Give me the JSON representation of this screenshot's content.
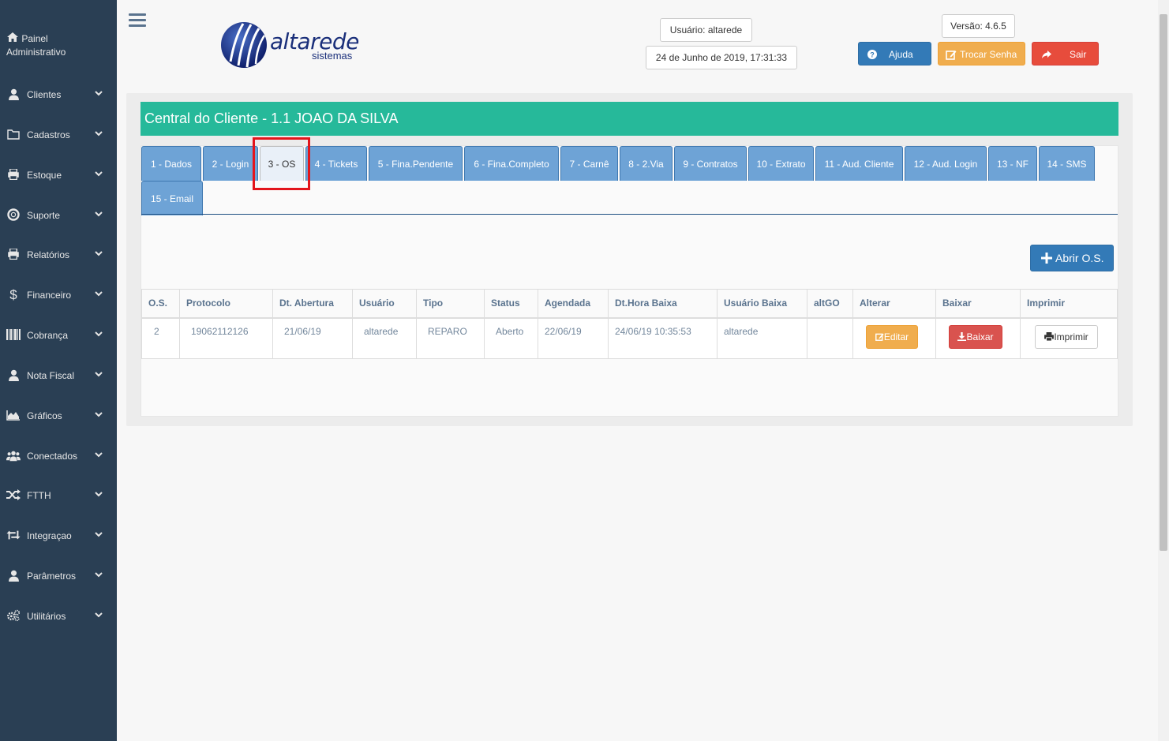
{
  "sidebar": {
    "home": {
      "line1": "Painel",
      "line2": "Administrativo"
    },
    "items": [
      {
        "label": "Clientes",
        "icon": "user-icon"
      },
      {
        "label": "Cadastros",
        "icon": "folder-icon"
      },
      {
        "label": "Estoque",
        "icon": "print-icon"
      },
      {
        "label": "Suporte",
        "icon": "life-ring-icon"
      },
      {
        "label": "Relatórios",
        "icon": "print-icon"
      },
      {
        "label": "Financeiro",
        "icon": "dollar-icon"
      },
      {
        "label": "Cobrança",
        "icon": "barcode-icon"
      },
      {
        "label": "Nota Fiscal",
        "icon": "user-icon"
      },
      {
        "label": "Gráficos",
        "icon": "area-chart-icon"
      },
      {
        "label": "Conectados",
        "icon": "users-icon"
      },
      {
        "label": "FTTH",
        "icon": "random-icon"
      },
      {
        "label": "Integraçao",
        "icon": "retweet-icon"
      },
      {
        "label": "Parâmetros",
        "icon": "user-icon"
      },
      {
        "label": "Utilitários",
        "icon": "cogs-icon"
      }
    ]
  },
  "header": {
    "logo_text": "altarede",
    "logo_sub": "sistemas",
    "user": "Usuário: altarede",
    "datetime": "24 de Junho de 2019, 17:31:33",
    "version": "Versão: 4.6.5",
    "help_label": "Ajuda",
    "password_label": "Trocar Senha",
    "exit_label": "Sair"
  },
  "panel": {
    "title": "Central do Cliente - 1.1 JOAO DA SILVA",
    "tabs": [
      "1 - Dados",
      "2 - Login",
      "3 - OS",
      "4 - Tickets",
      "5 - Fina.Pendente",
      "6 - Fina.Completo",
      "7 - Carnê",
      "8 - 2.Via",
      "9 - Contratos",
      "10 - Extrato",
      "11 - Aud. Cliente",
      "12 - Aud. Login",
      "13 - NF",
      "14 - SMS",
      "15 - Email"
    ],
    "active_tab": "3 - OS",
    "add_label": "Abrir O.S."
  },
  "table": {
    "headers": [
      "O.S.",
      "Protocolo",
      "Dt. Abertura",
      "Usuário",
      "Tipo",
      "Status",
      "Agendada",
      "Dt.Hora Baixa",
      "Usuário Baixa",
      "altGO",
      "Alterar",
      "Baixar",
      "Imprimir"
    ],
    "row": {
      "os": "2",
      "protocolo": "19062112126",
      "abertura": "21/06/19",
      "usuario": "altarede",
      "tipo": "REPARO",
      "status": "Aberto",
      "agendada": "22/06/19",
      "baixa": "24/06/19 10:35:53",
      "usuario_baixa": "altarede",
      "altgo": "",
      "edit_label": "Editar",
      "down_label": "Baixar",
      "print_label": "Imprimir"
    }
  },
  "colors": {
    "sidebar": "#2a3f54",
    "title_bar": "#26b99a",
    "tab": "#6ea3d6",
    "primary": "#337ab7",
    "warning": "#f0ad4e",
    "danger": "#e74c3c",
    "highlight": "#e3151b"
  }
}
